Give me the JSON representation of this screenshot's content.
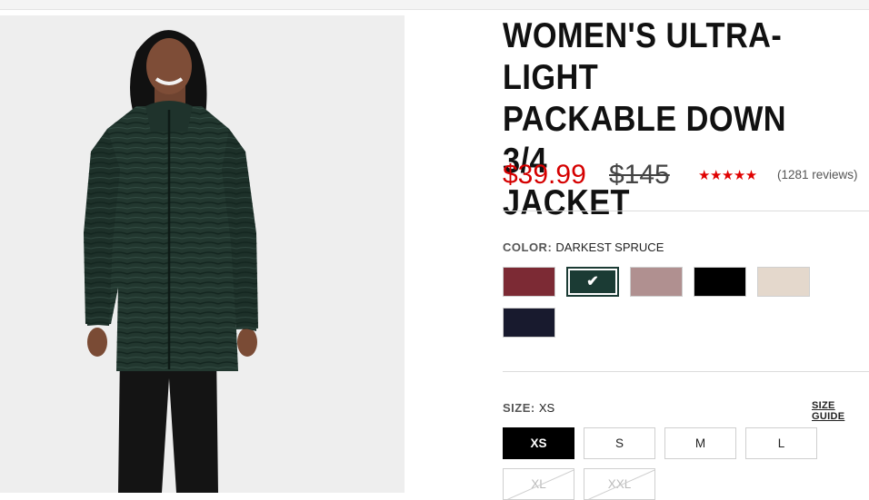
{
  "product": {
    "title_lines": [
      "WOMEN'S ULTRA-LIGHT",
      "PACKABLE DOWN 3/4",
      "JACKET"
    ],
    "sale_price": "$39.99",
    "original_price": "$145",
    "rating_stars": "★★★★★",
    "rating_value": 5,
    "reviews_text": "(1281 reviews)"
  },
  "color": {
    "label": "COLOR:",
    "selected": "DARKEST SPRUCE",
    "check_glyph": "✔",
    "swatches": [
      {
        "hex": "#7c2a34"
      },
      {
        "hex": "#1b3b34"
      },
      {
        "hex": "#b09090"
      },
      {
        "hex": "#000000"
      },
      {
        "hex": "#e4d8cc"
      },
      {
        "hex": "#181a2e"
      }
    ]
  },
  "size": {
    "label": "SIZE:",
    "selected": "XS",
    "guide_label": "SIZE GUIDE",
    "options": [
      {
        "label": "XS",
        "state": "selected"
      },
      {
        "label": "S",
        "state": "available"
      },
      {
        "label": "M",
        "state": "available"
      },
      {
        "label": "L",
        "state": "available"
      },
      {
        "label": "XL",
        "state": "unavailable"
      },
      {
        "label": "XXL",
        "state": "unavailable"
      }
    ]
  },
  "colors": {
    "sale_red": "#d50000",
    "star_red": "#e00000",
    "jacket_green": "#22372f"
  }
}
